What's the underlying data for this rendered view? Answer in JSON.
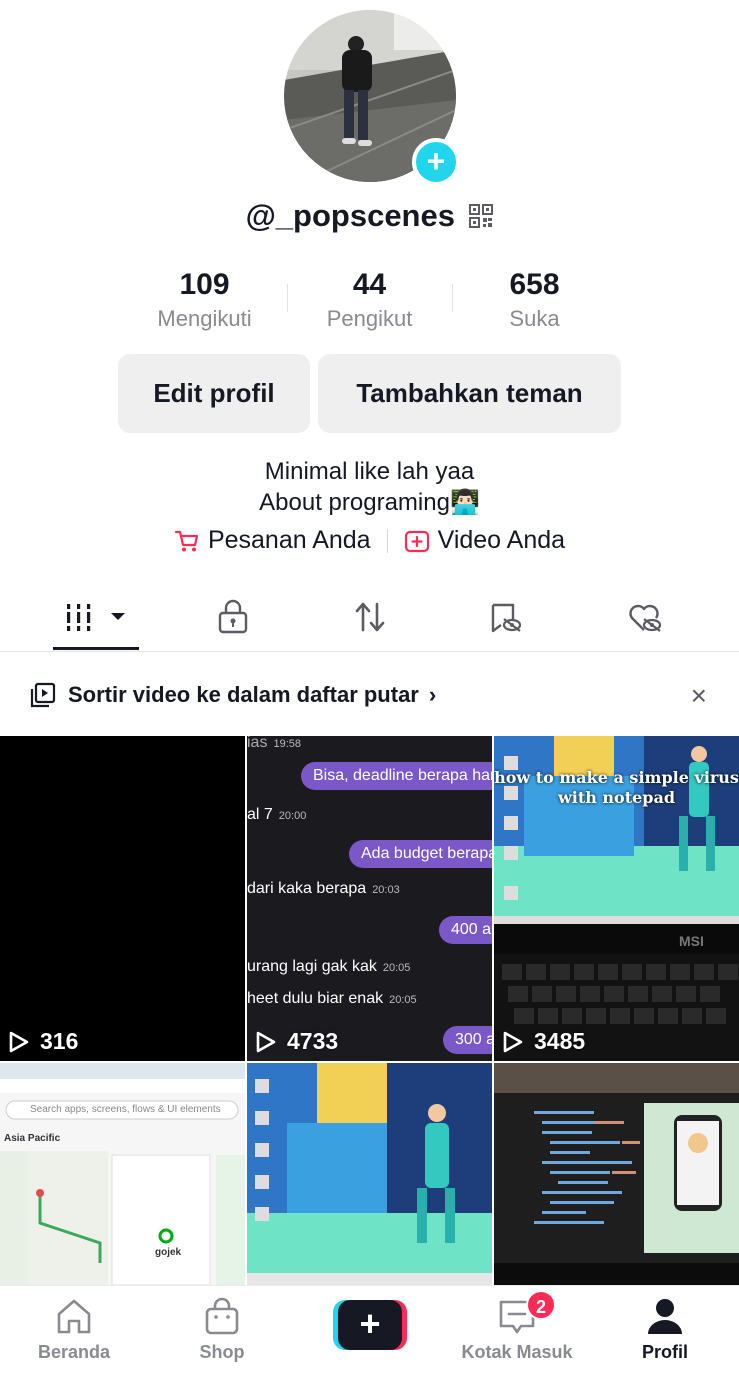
{
  "profile": {
    "username": "@_popscenes",
    "stats": [
      {
        "value": "109",
        "label": "Mengikuti"
      },
      {
        "value": "44",
        "label": "Pengikut"
      },
      {
        "value": "658",
        "label": "Suka"
      }
    ],
    "edit_button": "Edit profil",
    "add_friends_button": "Tambahkan teman",
    "bio_line1": "Minimal like lah yaa",
    "bio_line2": "About programing👨🏻‍💻",
    "orders_link": "Pesanan Anda",
    "video_link": "Video Anda"
  },
  "tabs": [
    {
      "icon": "grid-icon",
      "active": true
    },
    {
      "icon": "lock-icon",
      "active": false
    },
    {
      "icon": "repost-icon",
      "active": false
    },
    {
      "icon": "bookmark-icon",
      "active": false
    },
    {
      "icon": "liked-icon",
      "active": false
    }
  ],
  "banner": {
    "text": "Sortir video ke dalam daftar putar",
    "chevron": "›",
    "close": "×"
  },
  "videos": [
    {
      "views": "316"
    },
    {
      "views": "4733",
      "chat": {
        "top": "ias",
        "top_time": "19:58",
        "bubble1": "Bisa, deadline berapa har",
        "line1": "al 7",
        "line1_time": "20:00",
        "bubble2": "Ada budget berapa",
        "line2": "dari kaka berapa",
        "line2_time": "20:03",
        "bubble3": "400 a",
        "line3": "urang lagi gak kak",
        "line3_time": "20:05",
        "line4": "heet dulu biar enak",
        "line4_time": "20:05",
        "bubble4": "300 a"
      }
    },
    {
      "views": "3485",
      "caption": "how to make a simple virus with notepad"
    },
    {
      "views": "",
      "search_placeholder": "Search apps, screens, flows & UI elements",
      "region": "Asia Pacific",
      "brand": "gojek"
    },
    {
      "views": ""
    },
    {
      "views": ""
    }
  ],
  "nav": {
    "home": "Beranda",
    "shop": "Shop",
    "create": "+",
    "inbox": "Kotak Masuk",
    "inbox_badge": "2",
    "profile": "Profil"
  },
  "colors": {
    "accent_red": "#fe2c55",
    "accent_cyan": "#20d5ec",
    "text": "#161823",
    "muted": "#8a8b91"
  }
}
